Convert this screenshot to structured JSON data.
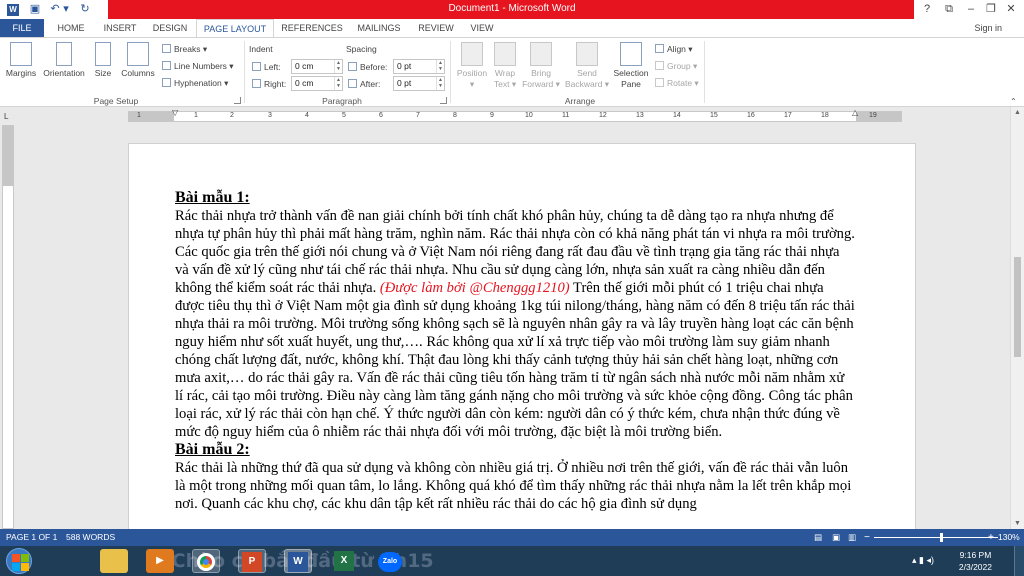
{
  "window": {
    "title": "Document1  -  Microsoft Word",
    "help": "?",
    "ribbon_opts": "⧉",
    "minimize": "–",
    "restore": "❐",
    "close": "✕"
  },
  "qat": {
    "save": "▣",
    "undo": "↶",
    "undo_dd": "▾",
    "redo": "↻",
    "customize": "≡"
  },
  "tabs": [
    {
      "label": "FILE"
    },
    {
      "label": "HOME"
    },
    {
      "label": "INSERT"
    },
    {
      "label": "DESIGN"
    },
    {
      "label": "PAGE LAYOUT"
    },
    {
      "label": "REFERENCES"
    },
    {
      "label": "MAILINGS"
    },
    {
      "label": "REVIEW"
    },
    {
      "label": "VIEW"
    }
  ],
  "signin": "Sign in",
  "ribbon": {
    "page_setup": {
      "margins": "Margins",
      "orientation": "Orientation",
      "size": "Size",
      "columns": "Columns",
      "breaks": "Breaks",
      "line_numbers": "Line Numbers",
      "hyphenation": "Hyphenation",
      "label": "Page Setup"
    },
    "paragraph": {
      "indent": "Indent",
      "spacing": "Spacing",
      "left_label": "Left:",
      "left_value": "0 cm",
      "right_label": "Right:",
      "right_value": "0 cm",
      "before_label": "Before:",
      "before_value": "0 pt",
      "after_label": "After:",
      "after_value": "0 pt",
      "label": "Paragraph"
    },
    "arrange": {
      "position": "Position",
      "wrap_text_1": "Wrap",
      "wrap_text_2": "Text",
      "bring_forward_1": "Bring",
      "bring_forward_2": "Forward",
      "send_backward_1": "Send",
      "send_backward_2": "Backward",
      "selection_pane_1": "Selection",
      "selection_pane_2": "Pane",
      "align": "Align",
      "group": "Group",
      "rotate": "Rotate",
      "label": "Arrange"
    }
  },
  "ruler": {
    "corner": "L",
    "numbers": [
      "1",
      "1",
      "2",
      "3",
      "4",
      "5",
      "6",
      "7",
      "8",
      "9",
      "10",
      "11",
      "12",
      "13",
      "14",
      "15",
      "16",
      "17",
      "18",
      "19"
    ]
  },
  "document": {
    "heading1": "Bài mẫu 1:",
    "para1_a": "Rác thải nhựa trở thành vấn đề nan giải chính bởi tính chất khó phân hủy, chúng ta dễ dàng tạo ra nhựa nhưng để nhựa tự phân hủy thì phải mất hàng trăm, nghìn năm. Rác thải nhựa còn có khả năng phát tán vi nhựa ra môi trường. Các quốc gia trên thế giới nói chung và ở Việt Nam nói riêng đang rất đau đầu về tình trạng gia tăng rác thải nhựa và vấn đề xử lý cũng như tái chế rác thải nhựa. Nhu cầu sử dụng càng lớn, nhựa sản xuất ra càng nhiều dẫn đến không thể kiểm soát rác thải nhựa. ",
    "credit": "(Được làm bởi @Chenggg1210)",
    "para1_b": " Trên thế giới mỗi phút có 1 triệu chai nhựa được tiêu thụ thì ở Việt Nam một gia đình sử dụng khoảng 1kg túi nilong/tháng, hàng năm có đến 8 triệu tấn rác thải nhựa thải ra môi trường. Môi trường sống không sạch sẽ là nguyên nhân gây ra và lây truyền hàng loạt các căn bệnh nguy hiểm như sốt xuất huyết, ung thư,…. Rác không qua xử lí xả trực tiếp vào môi trường làm suy giảm nhanh chóng chất lượng đất, nước, không khí. Thật đau lòng khi thấy cảnh tượng thủy hải sản chết hàng loạt, những cơn mưa axit,… do rác thải gây ra. Vấn đề rác thải cũng tiêu tốn hàng trăm tỉ từ ngân sách nhà nước mỗi năm nhằm xử lí rác, cải tạo môi trường. Điều này càng làm tăng gánh nặng cho môi trường và sức khỏe cộng đồng. Công tác phân loại rác, xử lý rác thải còn hạn chế. Ý thức người dân còn kém: người dân có ý thức kém, chưa nhận thức đúng về mức độ nguy hiểm của ô nhiễm rác thải nhựa đối với môi trường, đặc biệt là môi trường biển.",
    "heading2": "Bài mẫu 2:",
    "para2": "Rác thải là những thứ đã qua sử dụng và không còn nhiều giá trị. Ở nhiều nơi trên thế giới, vấn đề rác thải vẫn luôn là một trong những mối quan tâm, lo lắng. Không quá khó để tìm thấy những rác thải nhựa nằm la lết trên khắp mọi nơi. Quanh các khu chợ, các khu dân tập kết rất nhiều rác thải do các hộ gia đình sử dụng"
  },
  "status": {
    "page": "PAGE 1 OF 1",
    "words": "588 WORDS",
    "zoom_minus": "−",
    "zoom_plus": "+",
    "zoom": "130%"
  },
  "taskbar": {
    "ghost_text": "...Chào cờ bắt đầu từ 7h15",
    "apps": [
      "file-explorer",
      "media-player",
      "chrome",
      "powerpoint",
      "word",
      "excel",
      "zalo"
    ],
    "ppt_letter": "P",
    "word_letter": "W",
    "excel_letter": "X",
    "zalo_letter": "Zalo",
    "tray": "▴ ▮ ◂)",
    "time": "9:16 PM",
    "date": "2/3/2022"
  },
  "colors": {
    "word_blue": "#2b579a",
    "title_red": "#e5141f",
    "credit_red": "#e5141f",
    "taskbar": "#1f3d57"
  }
}
